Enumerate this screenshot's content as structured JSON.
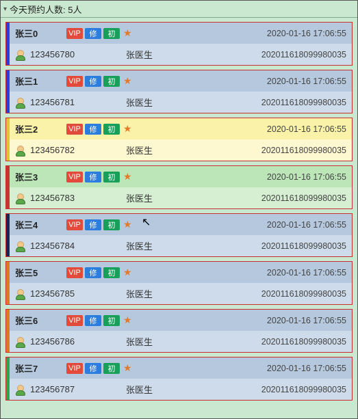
{
  "header": {
    "arrow": "▾",
    "title": "今天预约人数: 5人"
  },
  "badgeLabels": {
    "vip": "VIP",
    "xiu": "修",
    "chu": "初"
  },
  "rows": [
    {
      "name": "张三0",
      "phone": "123456780",
      "doctor": "张医生",
      "ts": "2020-01-16 17:06:55",
      "order": "202011618099980035",
      "stripe": "s0",
      "topClass": "g-blue",
      "botClass": "l-blue"
    },
    {
      "name": "张三1",
      "phone": "123456781",
      "doctor": "张医生",
      "ts": "2020-01-16 17:06:55",
      "order": "202011618099980035",
      "stripe": "s1",
      "topClass": "g-blue",
      "botClass": "l-blue"
    },
    {
      "name": "张三2",
      "phone": "123456782",
      "doctor": "张医生",
      "ts": "2020-01-16 17:06:55",
      "order": "202011618099980035",
      "stripe": "s2",
      "topClass": "g-yellow",
      "botClass": "l-yellow"
    },
    {
      "name": "张三3",
      "phone": "123456783",
      "doctor": "张医生",
      "ts": "2020-01-16 17:06:55",
      "order": "202011618099980035",
      "stripe": "s3",
      "topClass": "g-green",
      "botClass": "l-green"
    },
    {
      "name": "张三4",
      "phone": "123456784",
      "doctor": "张医生",
      "ts": "2020-01-16 17:06:55",
      "order": "202011618099980035",
      "stripe": "s4",
      "topClass": "g-blue",
      "botClass": "l-blue"
    },
    {
      "name": "张三5",
      "phone": "123456785",
      "doctor": "张医生",
      "ts": "2020-01-16 17:06:55",
      "order": "202011618099980035",
      "stripe": "s5",
      "topClass": "g-blue",
      "botClass": "l-blue"
    },
    {
      "name": "张三6",
      "phone": "123456786",
      "doctor": "张医生",
      "ts": "2020-01-16 17:06:55",
      "order": "202011618099980035",
      "stripe": "s6",
      "topClass": "g-blue",
      "botClass": "l-blue"
    },
    {
      "name": "张三7",
      "phone": "123456787",
      "doctor": "张医生",
      "ts": "2020-01-16 17:06:55",
      "order": "202011618099980035",
      "stripe": "s7",
      "topClass": "g-blue",
      "botClass": "l-blue"
    }
  ]
}
